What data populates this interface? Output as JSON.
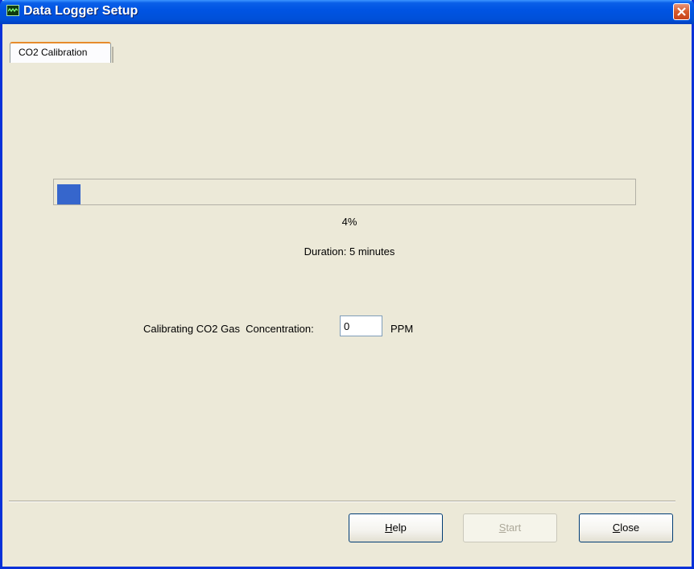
{
  "window": {
    "title": "Data Logger Setup"
  },
  "tabs": [
    {
      "label": "CO2 Calibration",
      "selected": true
    }
  ],
  "progress": {
    "value_percent": 4,
    "percent_label": "4%",
    "bar_color": "#3666cc"
  },
  "duration_text": "Duration: 5 minutes",
  "calibration": {
    "label": "Calibrating CO2 Gas  Concentration:",
    "value": "0",
    "unit": "PPM"
  },
  "buttons": {
    "help": {
      "mnemonic": "H",
      "rest": "elp"
    },
    "start": {
      "mnemonic": "S",
      "rest": "tart",
      "disabled": true
    },
    "close": {
      "mnemonic": "C",
      "rest": "lose"
    }
  },
  "colors": {
    "titlebar": "#0054e3",
    "dialog_bg": "#ece9d8",
    "close_button": "#d65a2a"
  }
}
